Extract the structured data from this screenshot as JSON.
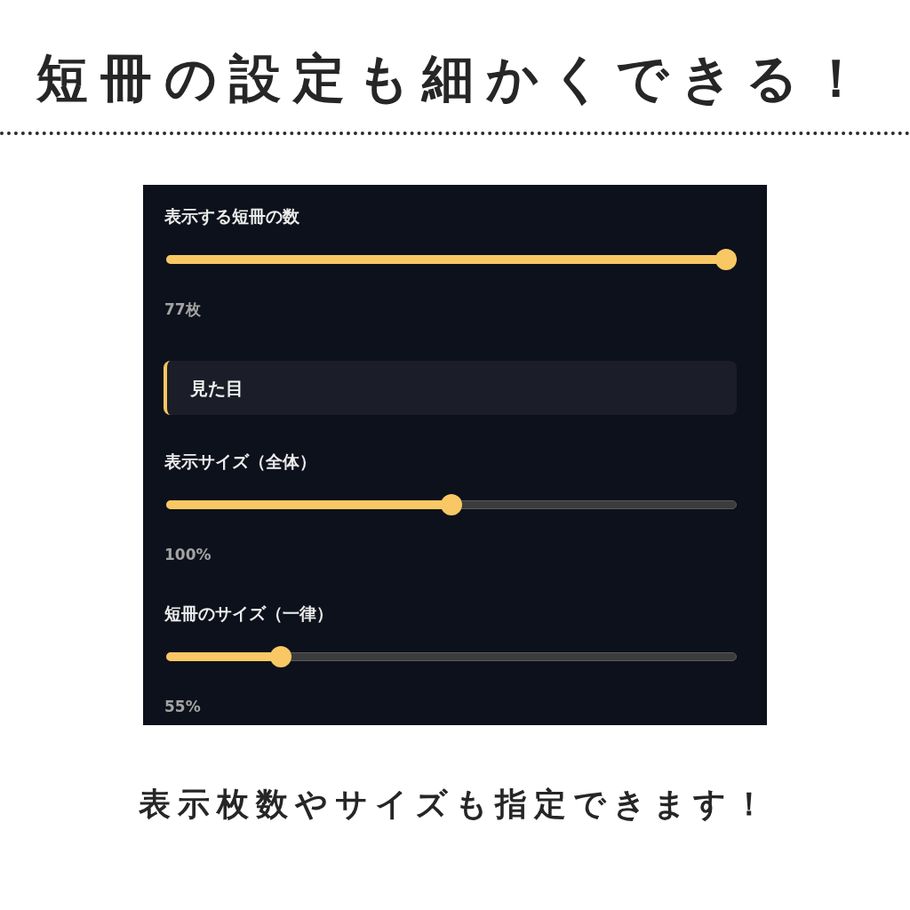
{
  "heading": "短冊の設定も細かくできる！",
  "panel": {
    "items": [
      {
        "kind": "slider",
        "label": "表示する短冊の数",
        "level": 1,
        "reading": "77枚"
      },
      {
        "kind": "section",
        "title": "見た目"
      },
      {
        "kind": "slider",
        "label": "表示サイズ（全体）",
        "level": 0.5,
        "reading": "100%"
      },
      {
        "kind": "slider",
        "label": "短冊のサイズ（一律）",
        "level": 0.19,
        "reading": "55%"
      }
    ]
  },
  "caption": "表示枚数やサイズも指定できます！"
}
